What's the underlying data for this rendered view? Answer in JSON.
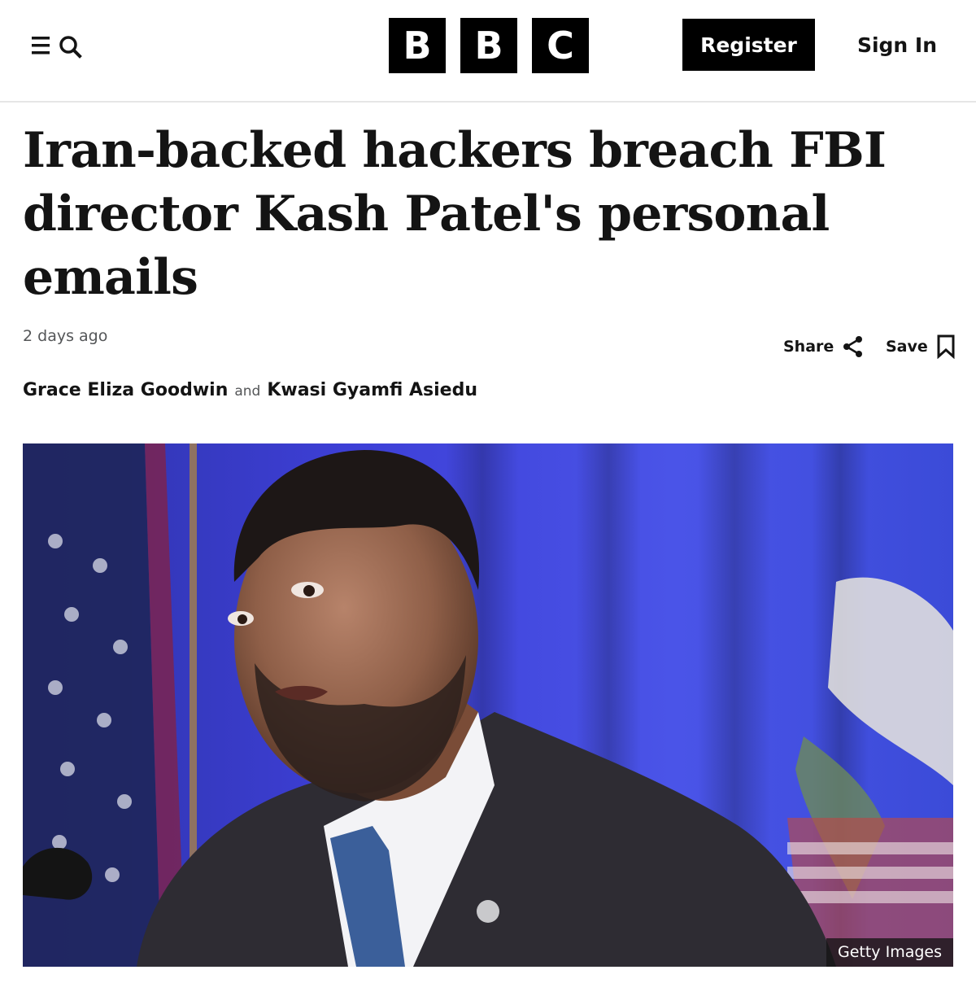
{
  "header": {
    "logo_letters": [
      "B",
      "B",
      "C"
    ],
    "register_label": "Register",
    "signin_label": "Sign In",
    "menu_icon": "menu-search-icon"
  },
  "article": {
    "headline": "Iran-backed hackers breach FBI director Kash Patel's personal emails",
    "timestamp": "2 days ago",
    "share_label": "Share",
    "save_label": "Save",
    "authors": [
      "Grace Eliza Goodwin",
      "Kwasi Gyamfi Asiedu"
    ],
    "author_joiner": "and"
  },
  "image": {
    "credit": "Getty Images"
  },
  "colors": {
    "brand_black": "#000000",
    "text": "#141414",
    "muted": "#545658",
    "background_blue": "#3a3fd0"
  }
}
